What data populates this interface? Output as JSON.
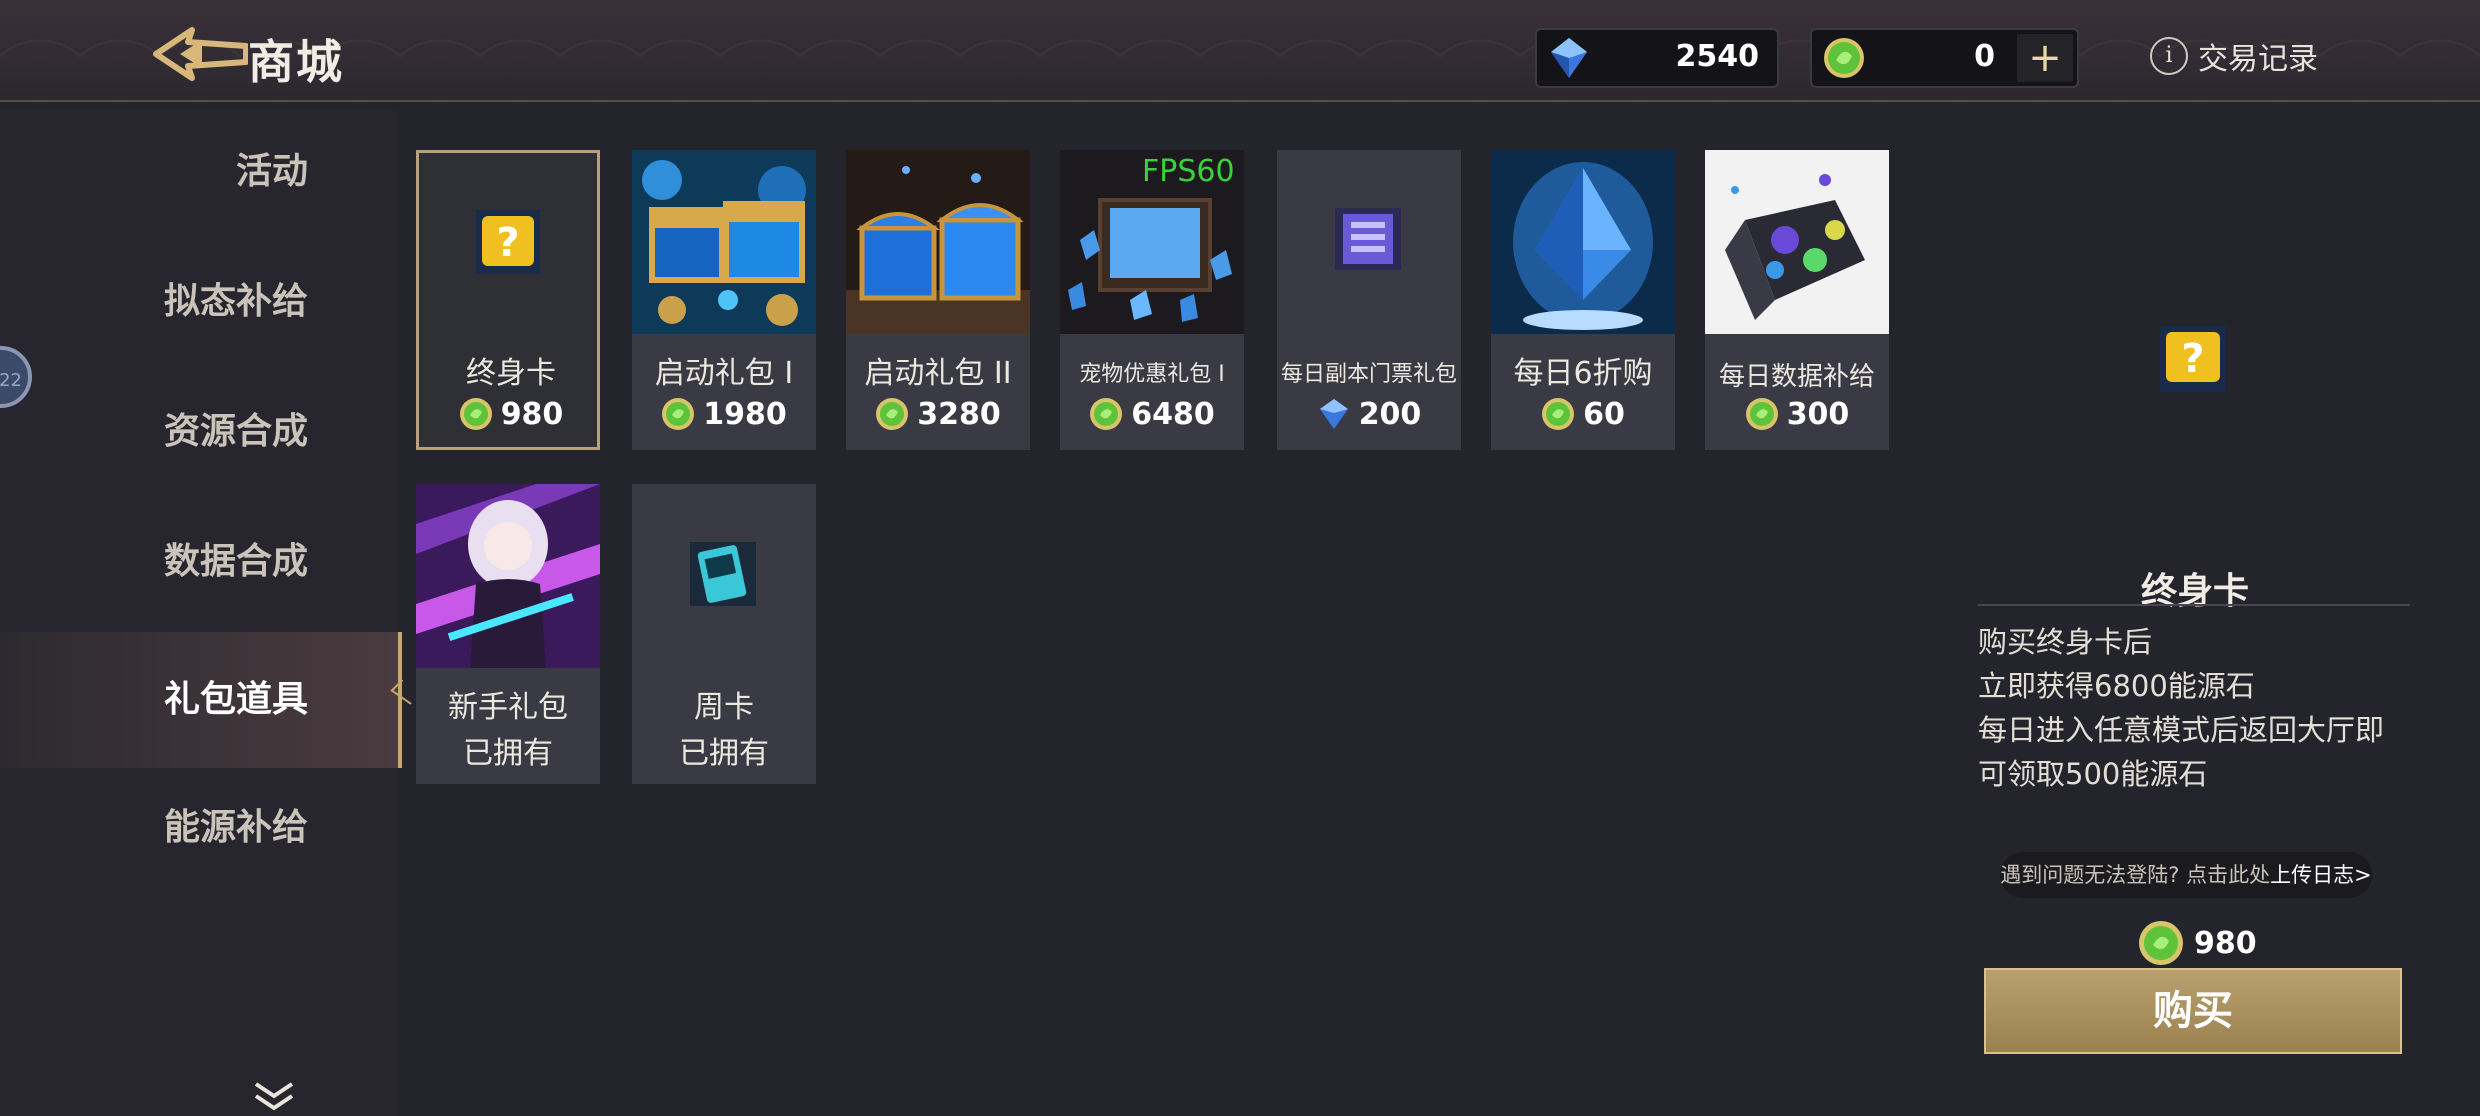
{
  "header": {
    "title": "商城",
    "gems": "2540",
    "coins": "0",
    "plus": "+",
    "trade_record": "交易记录"
  },
  "sidebar": {
    "items": [
      {
        "label": "活动"
      },
      {
        "label": "拟态补给"
      },
      {
        "label": "资源合成"
      },
      {
        "label": "数据合成"
      },
      {
        "label": "礼包道具"
      },
      {
        "label": "能源补给"
      }
    ],
    "active": "礼包道具",
    "bubble": "22"
  },
  "grid": {
    "items": [
      {
        "name": "终身卡",
        "price": "980",
        "currency": "green-coin",
        "selected": true
      },
      {
        "name": "启动礼包 I",
        "price": "1980",
        "currency": "green-coin"
      },
      {
        "name": "启动礼包 II",
        "price": "3280",
        "currency": "green-coin"
      },
      {
        "name": "宠物优惠礼包 I",
        "price": "6480",
        "currency": "green-coin"
      },
      {
        "name": "每日副本门票礼包",
        "price": "200",
        "currency": "blue-gem"
      },
      {
        "name": "每日6折购",
        "price": "60",
        "currency": "green-coin"
      },
      {
        "name": "每日数据补给",
        "price": "300",
        "currency": "green-coin"
      },
      {
        "name": "新手礼包",
        "status": "已拥有"
      },
      {
        "name": "周卡",
        "status": "已拥有"
      }
    ],
    "overlay_text": "FPS60"
  },
  "detail": {
    "title": "终身卡",
    "lines": [
      "购买终身卡后",
      "立即获得6800能源石",
      "每日进入任意模式后返回大厅即",
      "可领取500能源石"
    ],
    "report_text": "遇到问题无法登陆? 点击此处",
    "report_link": "上传日志>",
    "price": "980",
    "buy_label": "购买"
  },
  "colors": {
    "accent_gold": "#c9a96a",
    "green_coin": "#5fc23b",
    "blue_gem": "#3a78e0",
    "fps_green": "#3ad23a"
  }
}
